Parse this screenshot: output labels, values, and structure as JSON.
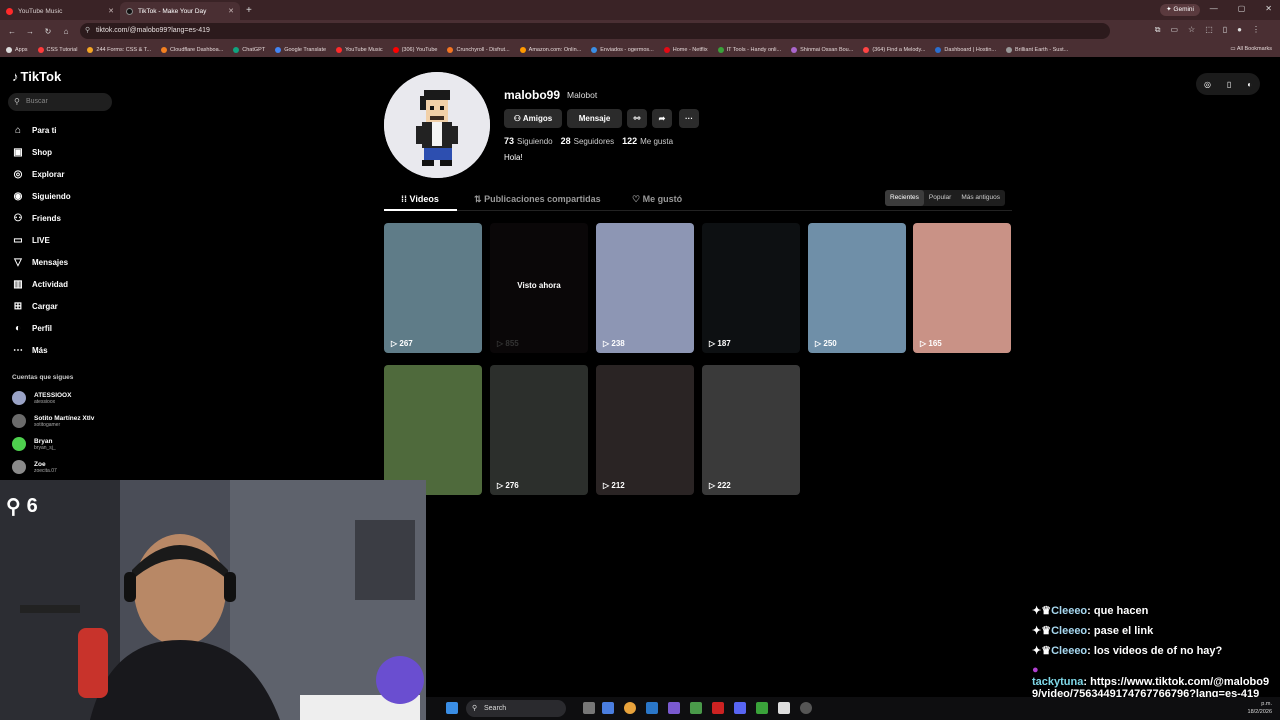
{
  "browser": {
    "tabs": [
      {
        "title": "YouTube Music",
        "color": "#ff2a2a"
      },
      {
        "title": "TikTok - Make Your Day",
        "color": "#111111"
      }
    ],
    "new_tab": "+",
    "gemini_label": "Gemini",
    "url": "tiktok.com/@malobo99?lang=es-419",
    "bookmarks": [
      "Apps",
      "CSS Tutorial",
      "244 Forms: CSS & T...",
      "Cloudflare Dashboa...",
      "ChatGPT",
      "Google Translate",
      "YouTube Music",
      "(306) YouTube",
      "Crunchyroll - Disfrut...",
      "Amazon.com: Onlin...",
      "Enviados - ogermos...",
      "Home - Netflix",
      "IT Tools - Handy onli...",
      "Shinmai Ossan Bou...",
      "(364) Find a Melody...",
      "Dashboard | Hostin...",
      "Brilliant Earth - Sust..."
    ],
    "all_bookmarks": "All Bookmarks"
  },
  "sidebar": {
    "logo": "TikTok",
    "search_placeholder": "Buscar",
    "items": [
      {
        "label": "Para ti",
        "icon": "home-icon"
      },
      {
        "label": "Shop",
        "icon": "shop-icon"
      },
      {
        "label": "Explorar",
        "icon": "compass-icon"
      },
      {
        "label": "Siguiendo",
        "icon": "following-icon"
      },
      {
        "label": "Friends",
        "icon": "friends-icon"
      },
      {
        "label": "LIVE",
        "icon": "live-icon"
      },
      {
        "label": "Mensajes",
        "icon": "messages-icon"
      },
      {
        "label": "Actividad",
        "icon": "activity-icon"
      },
      {
        "label": "Cargar",
        "icon": "upload-icon"
      },
      {
        "label": "Perfil",
        "icon": "profile-icon"
      },
      {
        "label": "Más",
        "icon": "more-icon"
      }
    ],
    "following_header": "Cuentas que sigues",
    "accounts": [
      {
        "name": "ATESSIOOX",
        "handle": "atessioox"
      },
      {
        "name": "Sotito Martínez Xtlv",
        "handle": "sotitogamer"
      },
      {
        "name": "Bryan",
        "handle": "bryan_sj_"
      },
      {
        "name": "Zoe",
        "handle": "zoecita.07"
      }
    ]
  },
  "profile": {
    "username": "malobo99",
    "nickname": "Malobot",
    "buttons": {
      "friends": "Amigos",
      "message": "Mensaje"
    },
    "stats": {
      "following_count": "73",
      "following_label": "Siguiendo",
      "followers_count": "28",
      "followers_label": "Seguidores",
      "likes_count": "122",
      "likes_label": "Me gusta"
    },
    "bio": "Hola!"
  },
  "tabs": {
    "videos": "Videos",
    "reposts": "Publicaciones compartidas",
    "liked": "Me gustó"
  },
  "sort": {
    "recent": "Recientes",
    "popular": "Popular",
    "oldest": "Más antiguos"
  },
  "videos": [
    {
      "views": "267",
      "color": "#5f7c88"
    },
    {
      "views": "855",
      "color": "#0a0708",
      "watched": "Visto ahora"
    },
    {
      "views": "238",
      "color": "#8d96b4"
    },
    {
      "views": "187",
      "color": "#0d1012"
    },
    {
      "views": "250",
      "color": "#6f8fa8"
    },
    {
      "views": "165",
      "color": "#c99286"
    },
    {
      "views": "",
      "color": "#4f6a3c"
    },
    {
      "views": "276",
      "color": "#2c2f2c"
    },
    {
      "views": "212",
      "color": "#2a2424"
    },
    {
      "views": "222",
      "color": "#3a3a3a"
    }
  ],
  "stream": {
    "viewers": "6",
    "chat": [
      {
        "user": "Cleeeo",
        "text": "que hacen"
      },
      {
        "user": "Cleeeo",
        "text": "pase el link"
      },
      {
        "user": "Cleeeo",
        "text": "los videos de of no hay?"
      },
      {
        "user": "tackytuna",
        "text": "https://www.tiktok.com/@malobo9",
        "text2": "9/video/7563449174767766796?lang=es-419"
      }
    ]
  },
  "taskbar": {
    "search": "Search",
    "time": "p.m.",
    "date": "18/2/2026"
  }
}
